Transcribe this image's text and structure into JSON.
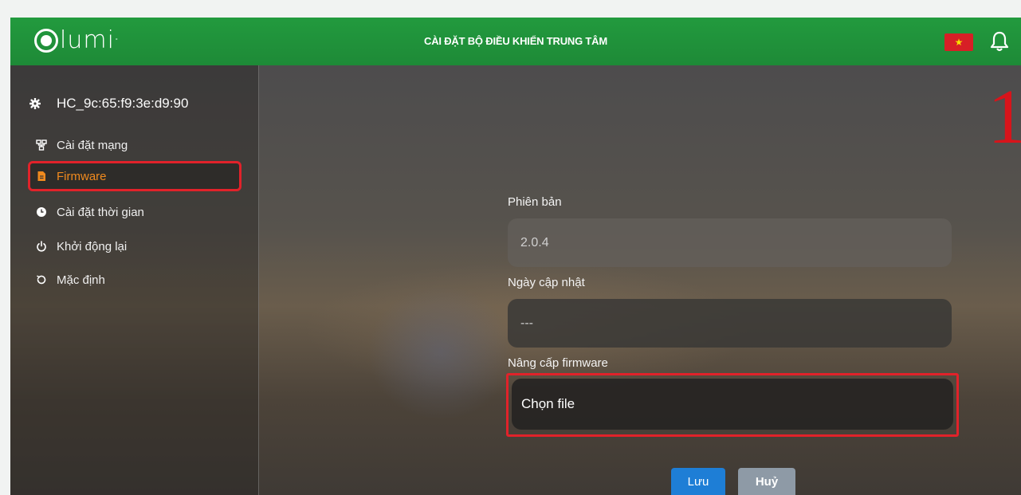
{
  "header": {
    "logo_text": "lumi",
    "title": "CÀI ĐẶT BỘ ĐIỀU KHIỂN TRUNG TÂM",
    "flag": "vietnam-flag-icon",
    "bell": "bell-icon"
  },
  "sidebar": {
    "device_name": "HC_9c:65:f9:3e:d9:90",
    "items": [
      {
        "label": "Cài đặt mạng",
        "icon": "network-icon"
      },
      {
        "label": "Firmware",
        "icon": "file-icon",
        "active": true
      },
      {
        "label": "Cài đặt thời gian",
        "icon": "clock-icon"
      },
      {
        "label": "Khởi động lại",
        "icon": "power-icon"
      },
      {
        "label": "Mặc định",
        "icon": "reset-icon"
      }
    ]
  },
  "form": {
    "version_label": "Phiên bản",
    "version_value": "2.0.4",
    "update_date_label": "Ngày cập nhật",
    "update_date_value": "---",
    "upgrade_label": "Nâng cấp firmware",
    "choose_file": "Chọn file"
  },
  "actions": {
    "save": "Lưu",
    "cancel": "Huỷ"
  },
  "annotation": "1",
  "colors": {
    "header_green": "#1e8a37",
    "highlight_red": "#e1222a",
    "active_orange": "#f08a1e",
    "save_blue": "#1e7ed6",
    "cancel_gray": "#8e9aa6"
  }
}
